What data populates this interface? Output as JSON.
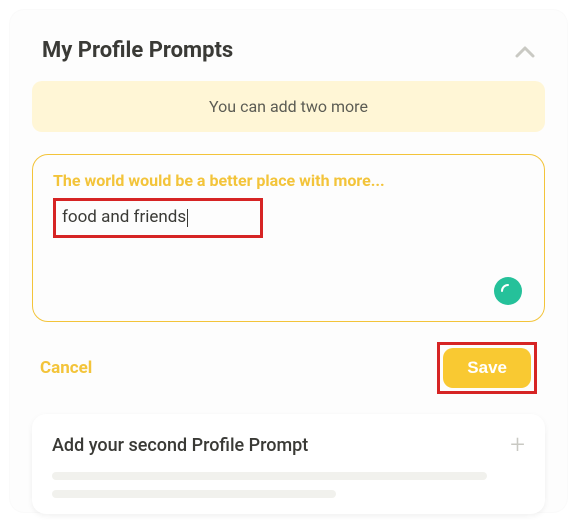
{
  "header": {
    "title": "My Profile Prompts"
  },
  "banner": {
    "text": "You can add two more"
  },
  "prompt": {
    "question": "The world would be a better place with more...",
    "answer": "food and friends"
  },
  "actions": {
    "cancel": "Cancel",
    "save": "Save"
  },
  "addPrompt": {
    "title": "Add your second Profile Prompt"
  },
  "colors": {
    "accent": "#f3c43a",
    "highlight": "#d62424",
    "statusGreen": "#25c19a"
  }
}
